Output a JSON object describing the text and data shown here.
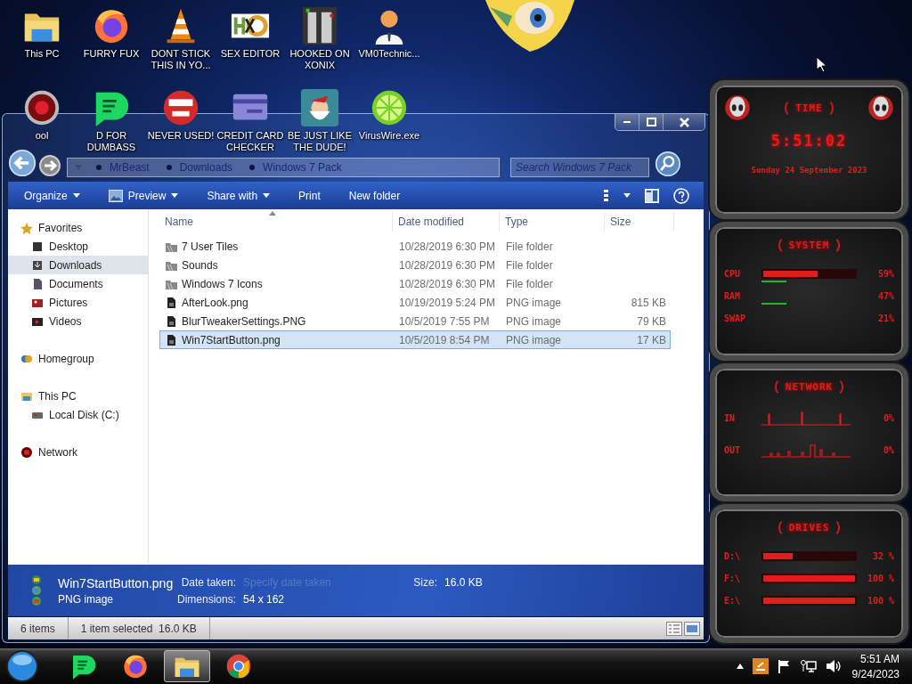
{
  "desktop": {
    "icons": [
      {
        "label": "This PC",
        "kind": "folder"
      },
      {
        "label": "FURRY FUX",
        "kind": "firefox"
      },
      {
        "label": "DONT STICK THIS IN YO...",
        "kind": "cone"
      },
      {
        "label": "SEX EDITOR",
        "kind": "hex"
      },
      {
        "label": "HOOKED ON XONIX",
        "kind": "game"
      },
      {
        "label": "VM0Technic...",
        "kind": "person"
      },
      {
        "label": "ool",
        "kind": "orb"
      },
      {
        "label": "D FOR DUMBASS",
        "kind": "chat"
      },
      {
        "label": "NEVER USED!",
        "kind": "dev"
      },
      {
        "label": "CREDIT CARD CHECKER",
        "kind": "card"
      },
      {
        "label": "BE JUST LIKE THE DUDE!",
        "kind": "elf"
      },
      {
        "label": "VirusWire.exe",
        "kind": "lime"
      }
    ]
  },
  "explorer": {
    "breadcrumbs": [
      "MrBeast",
      "Downloads",
      "Windows 7 Pack"
    ],
    "search": {
      "placeholder": "Search Windows 7 Pack"
    },
    "toolbar": [
      {
        "label": "Organize",
        "kind": "menu"
      },
      {
        "label": "Preview",
        "kind": "preview"
      },
      {
        "label": "Share with",
        "kind": "menu"
      },
      {
        "label": "Print",
        "kind": "plain"
      },
      {
        "label": "New folder",
        "kind": "plain"
      }
    ],
    "nav": [
      {
        "label": "Favorites",
        "kind": "star",
        "selected": false,
        "children": [
          {
            "label": "Desktop",
            "kind": "desktop",
            "selected": false
          },
          {
            "label": "Downloads",
            "kind": "downloads",
            "selected": true
          },
          {
            "label": "Documents",
            "kind": "documents",
            "selected": false
          },
          {
            "label": "Pictures",
            "kind": "pictures",
            "selected": false
          },
          {
            "label": "Videos",
            "kind": "videos",
            "selected": false
          }
        ]
      },
      {
        "label": "Homegroup",
        "kind": "homegroup",
        "selected": false
      },
      {
        "label": "This PC",
        "kind": "pc",
        "selected": false,
        "children": [
          {
            "label": "Local Disk (C:)",
            "kind": "disk",
            "selected": false
          }
        ]
      },
      {
        "label": "Network",
        "kind": "network",
        "selected": false
      }
    ],
    "columns": [
      "Name",
      "Date modified",
      "Type",
      "Size"
    ],
    "rows": [
      {
        "name": "7 User Tiles",
        "date": "10/28/2019 6:30 PM",
        "type": "File folder",
        "kind": "folder",
        "selected": false
      },
      {
        "name": "Sounds",
        "date": "10/28/2019 6:30 PM",
        "type": "File folder",
        "kind": "folder",
        "selected": false
      },
      {
        "name": "Windows 7 Icons",
        "date": "10/28/2019 6:30 PM",
        "type": "File folder",
        "kind": "folder",
        "selected": false
      },
      {
        "name": "AfterLook.png",
        "date": "10/19/2019 5:24 PM",
        "type": "PNG image",
        "size": "815 KB",
        "kind": "image",
        "selected": false
      },
      {
        "name": "BlurTweakerSettings.PNG",
        "date": "10/5/2019 7:55 PM",
        "type": "PNG image",
        "size": "79 KB",
        "kind": "image",
        "selected": false
      },
      {
        "name": "Win7StartButton.png",
        "date": "10/5/2019 8:54 PM",
        "type": "PNG image",
        "size": "17 KB",
        "kind": "image",
        "selected": true
      }
    ],
    "details": {
      "name": "Win7StartButton.png",
      "type": "PNG image",
      "fields": [
        {
          "label": "Date taken:",
          "value": "Specify date taken",
          "kind": "placeholder"
        },
        {
          "label": "Dimensions:",
          "value": "54 x 162",
          "kind": "value"
        },
        {
          "label": "Size:",
          "value": "16.0 KB",
          "kind": "value"
        }
      ]
    },
    "status": {
      "items": "6 items",
      "selection": "1 item selected  16.0 KB"
    }
  },
  "gadget": {
    "panels": [
      {
        "kind": "time",
        "title": "TIME",
        "time": "5:51:02",
        "date": "Sunday 24 September 2023"
      },
      {
        "kind": "meters",
        "title": "SYSTEM",
        "rows": [
          {
            "label": "CPU",
            "kind": "chevrons",
            "level": 0.59,
            "reading": "59%"
          },
          {
            "label": "RAM",
            "kind": "line",
            "reading": "47%"
          },
          {
            "label": "SWAP",
            "kind": "line",
            "reading": "21%"
          }
        ]
      },
      {
        "kind": "graphs",
        "title": "NETWORK",
        "rows": [
          {
            "label": "IN",
            "reading": "0%"
          },
          {
            "label": "OUT",
            "reading": "0%"
          }
        ]
      },
      {
        "kind": "meters",
        "title": "DRIVES",
        "rows": [
          {
            "label": "D:\\",
            "kind": "chevrons",
            "level": 0.32,
            "reading": "32 %"
          },
          {
            "label": "F:\\",
            "kind": "chevrons",
            "level": 1,
            "reading": "100 %"
          },
          {
            "label": "E:\\",
            "kind": "chevrons",
            "level": 1,
            "reading": "100 %"
          }
        ]
      }
    ]
  },
  "taskbar": {
    "apps": [
      {
        "kind": "chat",
        "active": false
      },
      {
        "kind": "firefox",
        "active": false
      },
      {
        "kind": "explorer",
        "active": true
      },
      {
        "kind": "chrome",
        "active": false
      }
    ],
    "clock": {
      "time": "5:51 AM",
      "date": "9/24/2023"
    }
  }
}
